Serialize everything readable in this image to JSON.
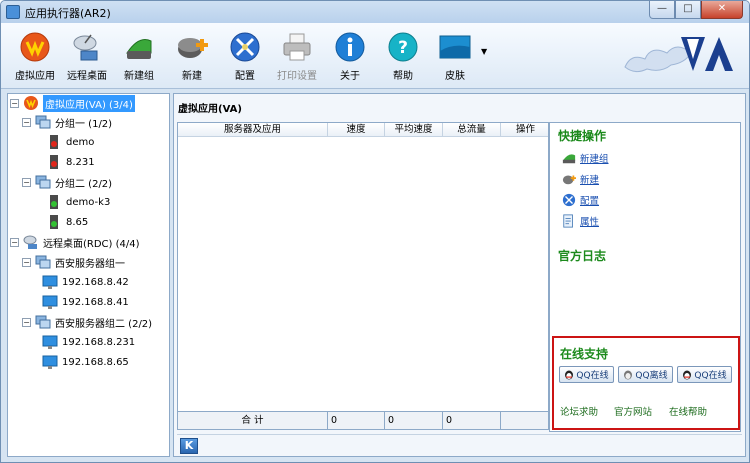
{
  "window": {
    "title": "应用执行器(AR2)"
  },
  "toolbar": {
    "virtual_app": "虚拟应用",
    "remote_desktop": "远程桌面",
    "new_group": "新建组",
    "new": "新建",
    "config": "配置",
    "print_settings": "打印设置",
    "about": "关于",
    "help": "帮助",
    "skin": "皮肤"
  },
  "tree": {
    "virtual_root": "虚拟应用(VA) (3/4)",
    "group1": "分组一 (1/2)",
    "group1_item1": "demo",
    "group1_item2": "8.231",
    "group2": "分组二 (2/2)",
    "group2_item1": "demo-k3",
    "group2_item2": "8.65",
    "rdc_root": "远程桌面(RDC) (4/4)",
    "rdc_group1": "西安服务器组一",
    "rdc_group1_item1": "192.168.8.42",
    "rdc_group1_item2": "192.168.8.41",
    "rdc_group2": "西安服务器组二 (2/2)",
    "rdc_group2_item1": "192.168.8.231",
    "rdc_group2_item2": "192.168.8.65"
  },
  "main": {
    "title": "虚拟应用(VA)",
    "columns": [
      "服务器及应用",
      "速度",
      "平均速度",
      "总流量",
      "操作"
    ],
    "footer": {
      "total_label": "合 计",
      "v1": "0",
      "v2": "0",
      "v3": "0"
    },
    "k_label": "K"
  },
  "side": {
    "quick_ops_title": "快捷操作",
    "quick_ops": [
      "新建组",
      "新建",
      "配置",
      "属性"
    ],
    "official_log_title": "官方日志",
    "online_support_title": "在线支持",
    "qq_buttons": [
      "QQ在线",
      "QQ离线",
      "QQ在线"
    ],
    "links": [
      "论坛求助",
      "官方网站",
      "在线帮助"
    ]
  },
  "colors": {
    "accent_green": "#1c8a1c",
    "selection_blue": "#3399ff",
    "support_border": "#cc1414"
  }
}
